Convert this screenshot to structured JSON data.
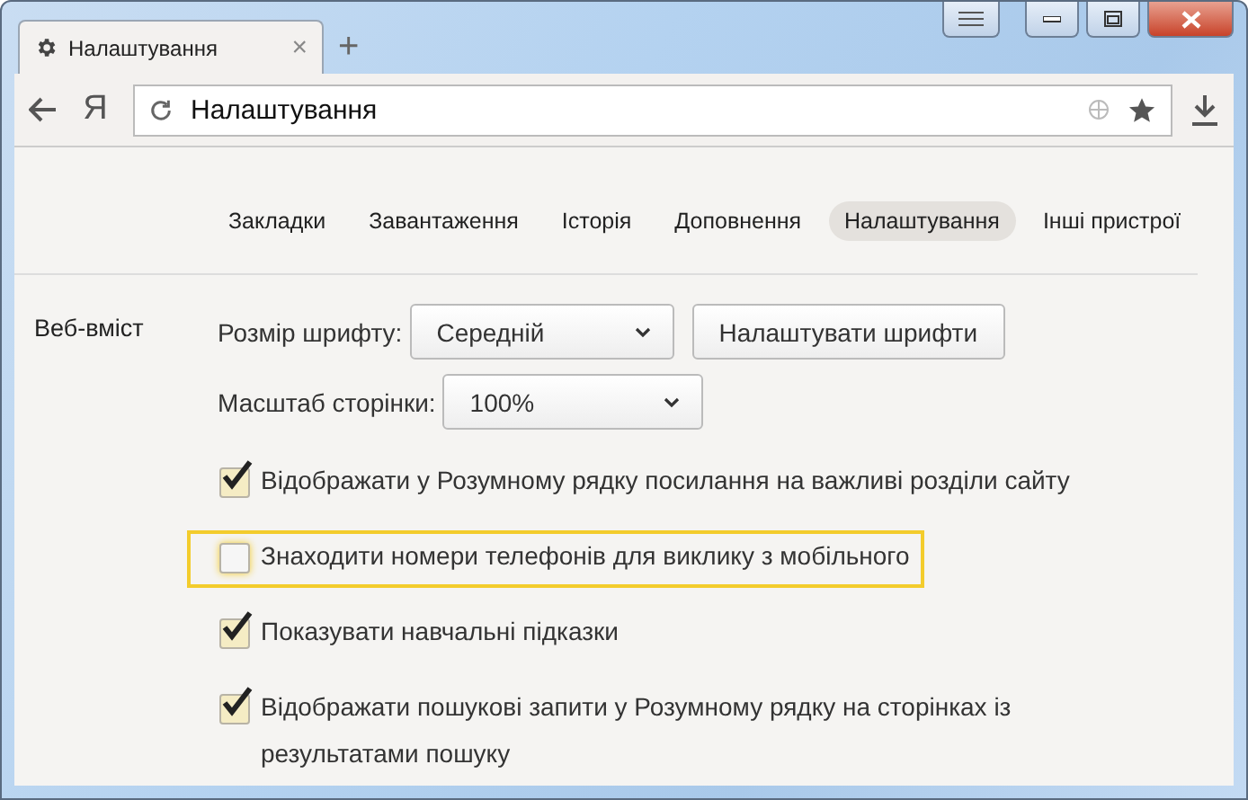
{
  "tab": {
    "title": "Налаштування",
    "close": "×",
    "new_tab": "+"
  },
  "toolbar": {
    "logo": "Я",
    "address": "Налаштування"
  },
  "nav": [
    {
      "label": "Закладки",
      "selected": false
    },
    {
      "label": "Завантаження",
      "selected": false
    },
    {
      "label": "Історія",
      "selected": false
    },
    {
      "label": "Доповнення",
      "selected": false
    },
    {
      "label": "Налаштування",
      "selected": true
    },
    {
      "label": "Інші пристрої",
      "selected": false
    }
  ],
  "section": {
    "title": "Веб-вміст",
    "font_size": {
      "label": "Розмір шрифту:",
      "value": "Середній",
      "button": "Налаштувати шрифти"
    },
    "zoom": {
      "label": "Масштаб сторінки:",
      "value": "100%"
    },
    "options": [
      {
        "label": "Відображати у Розумному рядку посилання на важливі розділи сайту",
        "checked": true,
        "highlighted": false
      },
      {
        "label": "Знаходити номери телефонів для виклику з мобільного",
        "checked": false,
        "highlighted": true
      },
      {
        "label": "Показувати навчальні підказки",
        "checked": true,
        "highlighted": false
      },
      {
        "label": "Відображати пошукові запити у Розумному рядку на сторінках із результатами пошуку",
        "checked": true,
        "highlighted": false
      }
    ]
  }
}
